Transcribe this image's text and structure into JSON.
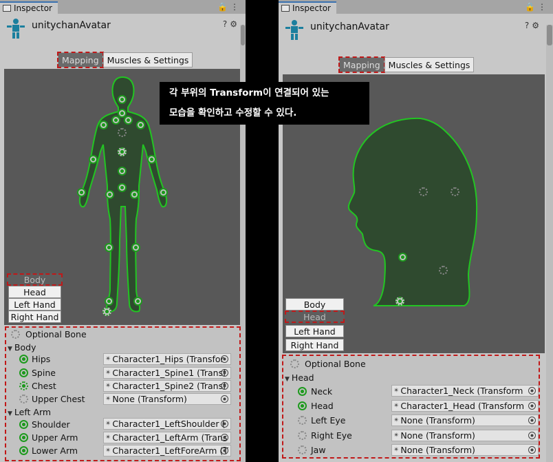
{
  "left": {
    "tab_label": "Inspector",
    "avatar_name": "unitychanAvatar",
    "seg_mapping": "Mapping",
    "seg_muscles": "Muscles & Settings",
    "side_buttons": [
      "Body",
      "Head",
      "Left Hand",
      "Right Hand"
    ],
    "optional_bone": "Optional Bone",
    "groups": [
      {
        "name": "Body",
        "rows": [
          {
            "label": "Hips",
            "value": "Character1_Hips (Transfor",
            "state": "solid"
          },
          {
            "label": "Spine",
            "value": "Character1_Spine1 (Transf",
            "state": "solid"
          },
          {
            "label": "Chest",
            "value": "Character1_Spine2 (Transf",
            "state": "dashed"
          },
          {
            "label": "Upper Chest",
            "value": "None (Transform)",
            "state": "empty"
          }
        ]
      },
      {
        "name": "Left Arm",
        "rows": [
          {
            "label": "Shoulder",
            "value": "Character1_LeftShoulder (",
            "state": "solid"
          },
          {
            "label": "Upper Arm",
            "value": "Character1_LeftArm (Trans",
            "state": "solid"
          },
          {
            "label": "Lower Arm",
            "value": "Character1_LeftForeArm (T",
            "state": "solid"
          }
        ]
      }
    ]
  },
  "right": {
    "tab_label": "Inspector",
    "avatar_name": "unitychanAvatar",
    "seg_mapping": "Mapping",
    "seg_muscles": "Muscles & Settings",
    "side_buttons": [
      "Body",
      "Head",
      "Left Hand",
      "Right Hand"
    ],
    "optional_bone": "Optional Bone",
    "group": "Head",
    "rows": [
      {
        "label": "Neck",
        "value": "Character1_Neck (Transform",
        "state": "solid"
      },
      {
        "label": "Head",
        "value": "Character1_Head (Transform",
        "state": "solid"
      },
      {
        "label": "Left Eye",
        "value": "None (Transform)",
        "state": "empty"
      },
      {
        "label": "Right Eye",
        "value": "None (Transform)",
        "state": "empty"
      },
      {
        "label": "Jaw",
        "value": "None (Transform)",
        "state": "empty"
      }
    ]
  },
  "callout": {
    "line1": "각 부위의 Transform이 연결되어 있는",
    "line2": "모습을 확인하고 수정할 수 있다."
  },
  "colors": {
    "bone_green": "#1d9a1d",
    "highlight_red": "#c01818"
  }
}
